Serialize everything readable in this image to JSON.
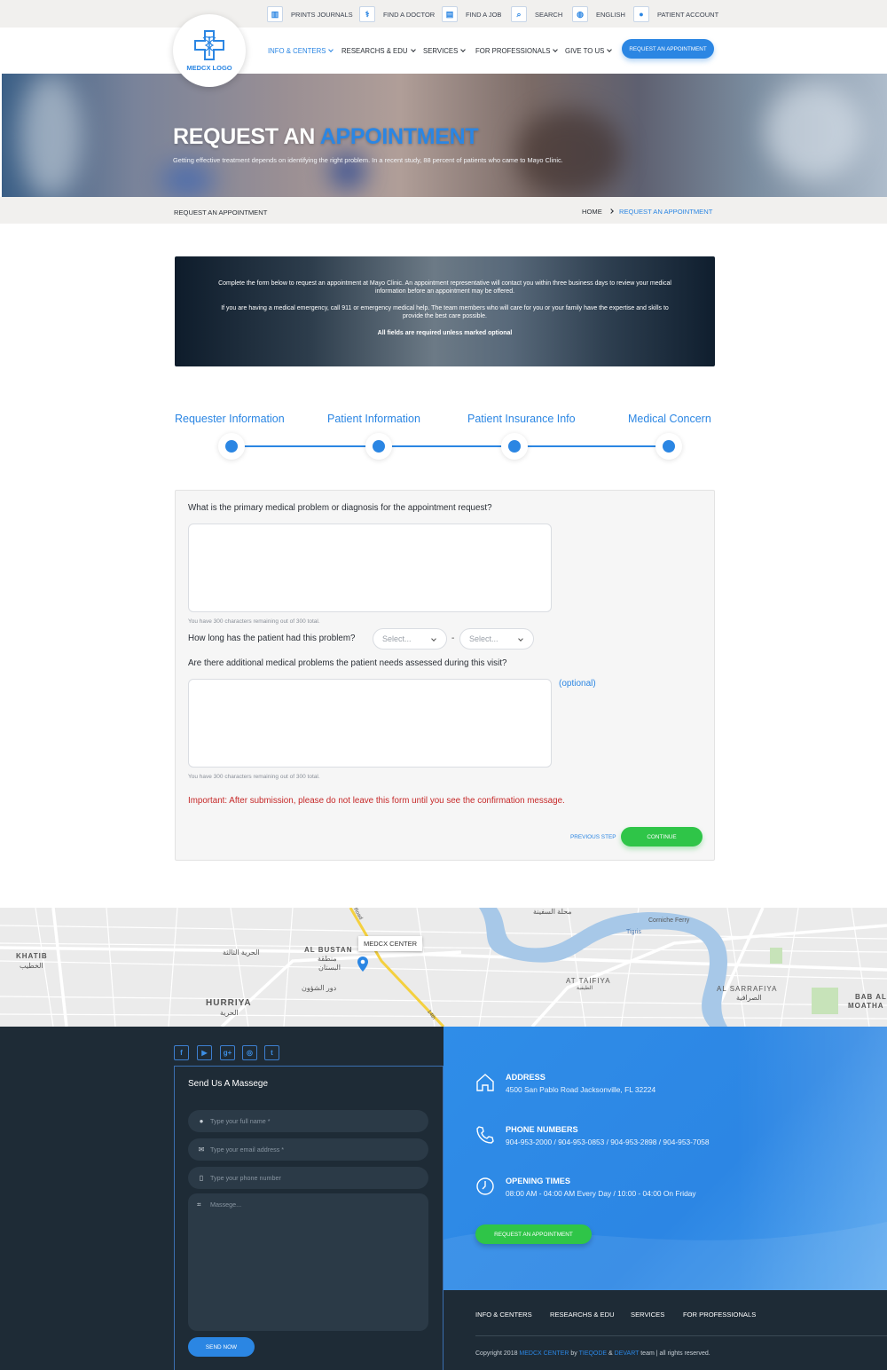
{
  "topbar": {
    "items": [
      {
        "label": "PRINTS JOURNALS",
        "icon": "journal-icon"
      },
      {
        "label": "FIND A DOCTOR",
        "icon": "doctor-icon"
      },
      {
        "label": "FIND A JOB",
        "icon": "document-icon"
      },
      {
        "label": "SEARCH",
        "icon": "search-icon"
      },
      {
        "label": "ENGLISH",
        "icon": "globe-icon"
      },
      {
        "label": "PATIENT ACCOUNT",
        "icon": "user-icon"
      }
    ]
  },
  "logo": {
    "text": "MEDCX LOGO"
  },
  "nav": {
    "items": [
      "INFO & CENTERS",
      "RESEARCHS & EDU",
      "SERVICES",
      "FOR PROFESSIONALS",
      "GIVE TO US"
    ],
    "cta": "REQUEST AN APPOINTMENT"
  },
  "hero": {
    "title_main": "REQUEST AN ",
    "title_highlight": "APPOINTMENT",
    "subtitle": "Getting effective treatment depends on identifying the right problem. In a recent study, 88 percent of patients who came to Mayo Clinic."
  },
  "breadcrumb": {
    "page": "REQUEST AN APPOINTMENT",
    "home": "HOME",
    "current": "REQUEST AN APPOINTMENT"
  },
  "info_box": {
    "para1": "Complete the form below to request an appointment at Mayo Clinic. An appointment representative will contact you within three business days to review your medical information before an appointment may be offered.",
    "para2": "If you are having a medical emergency, call 911 or emergency medical help. The team members who will care for you or your family have the expertise and skills to provide the best care possible.",
    "para3": "All fields are required unless marked optional"
  },
  "steps": [
    "Requester Information",
    "Patient Information",
    "Patient Insurance Info",
    "Medical Concern"
  ],
  "form": {
    "q1": "What is the primary medical problem or diagnosis for the appointment request?",
    "q1_hint": "You have 300 characters remaining out of 300 total.",
    "q2": "How long has the patient had this problem?",
    "select1": "Select...",
    "select_dash": "-",
    "select2": "Select...",
    "q3": "Are there additional medical problems the patient needs assessed during this visit?",
    "q3_optional": "(optional)",
    "q3_hint": "You have 300 characters remaining out of 300 total.",
    "important": "Important: After submission, please do not leave this form until you see the confirmation message.",
    "prev": "PREVIOUS STEP",
    "continue": "CONTINUE"
  },
  "map": {
    "marker_label": "MEDCX CENTER",
    "labels": [
      "KHATIB",
      "الخطيب",
      "AL BUSTAN",
      "منطقة",
      "البستان",
      "HURRIYA",
      "الحرية",
      "AT TAIFIYA",
      "الطيفية",
      "AL SARRAFIYA",
      "الصرافية",
      "Corniche Ferry",
      "Tigris",
      "BAB AL",
      "MOATHA",
      "الحرية الثالثة",
      "دور الشؤون",
      "محلة السفينة",
      "Road",
      "14th"
    ]
  },
  "footer": {
    "socials": [
      "facebook-icon",
      "youtube-icon",
      "google-plus-icon",
      "instagram-icon",
      "twitter-icon"
    ],
    "social_glyphs": [
      "f",
      "▶",
      "g+",
      "◎",
      "t"
    ],
    "send_title": "Send Us A Massege",
    "name_placeholder": "Type your full name *",
    "email_placeholder": "Type your email address *",
    "phone_placeholder": "Type your phone number",
    "message_placeholder": "Massege...",
    "send_btn": "SEND NOW",
    "address_title": "ADDRESS",
    "address": "4500 San Pablo Road Jacksonville, FL 32224",
    "phones_title": "PHONE NUMBERS",
    "phones": "904-953-2000 / 904-953-0853 / 904-953-2898 / 904-953-7058",
    "hours_title": "OPENING TIMES",
    "hours": "08:00 AM - 04:00 AM Every Day / 10:00 - 04:00 On Friday",
    "cta": "REQUEST AN APPOINTMENT",
    "nav": [
      "INFO & CENTERS",
      "RESEARCHS & EDU",
      "SERVICES",
      "FOR PROFESSIONALS"
    ],
    "copy_pre": "Copyright 2018 ",
    "copy_brand": "MEDCX CENTER",
    "copy_by": " by ",
    "copy_t1": "TIEQODE",
    "copy_amp": " & ",
    "copy_t2": "DEVART",
    "copy_post": " team | all rights reserved."
  },
  "colors": {
    "accent": "#2b86e3",
    "success": "#2fc548",
    "danger": "#c62828",
    "footer_dark": "#1e2b36"
  }
}
